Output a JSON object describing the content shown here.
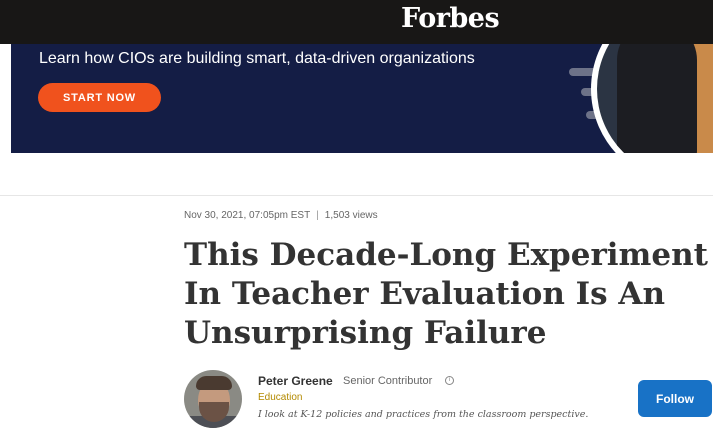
{
  "header": {
    "logo": "Forbes"
  },
  "ad": {
    "headline": "Learn how CIOs are building smart, data-driven organizations",
    "cta_label": "START NOW"
  },
  "article": {
    "meta": {
      "date": "Nov 30, 2021, 07:05pm EST",
      "separator": "|",
      "views": "1,503 views"
    },
    "title": "This Decade-Long Experiment In Teacher Evaluation Is An Unsurprising Failure"
  },
  "author": {
    "name": "Peter Greene",
    "role": "Senior Contributor",
    "section": "Education",
    "bio": "I look at K-12 policies and practices from the classroom perspective.",
    "follow_label": "Follow"
  },
  "colors": {
    "topbar": "#181716",
    "ad_bg": "#141d45",
    "cta": "#f0521d",
    "follow": "#1872c6",
    "section": "#b38a00"
  }
}
